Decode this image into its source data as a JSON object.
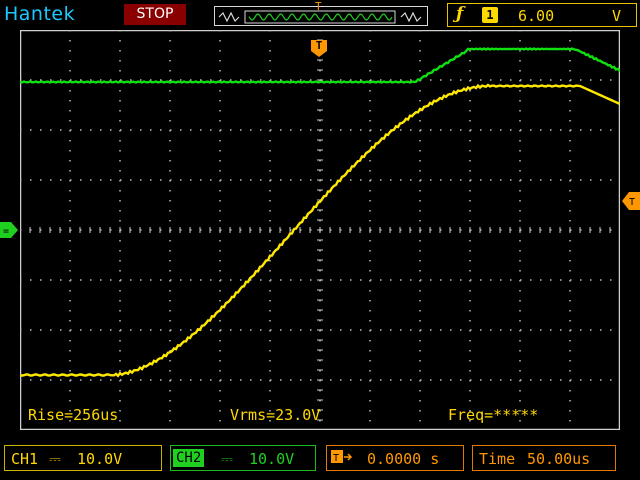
{
  "header": {
    "brand": "Hantek",
    "run_state": "STOP",
    "trigger_marker": "T",
    "trigger_icon": "trigger-edge-icon",
    "trigger_channel": "1",
    "trigger_level": "6.00",
    "trigger_unit": "V"
  },
  "screen": {
    "trigger_position_label": "T",
    "colors": {
      "ch1": "#ffe800",
      "ch2": "#10e010",
      "grid": "#ffffff",
      "trigger": "#ff9800"
    }
  },
  "measurements": {
    "rise": "Rise=256us",
    "vrms": "Vrms=23.0V",
    "freq": "Freq=*****"
  },
  "footer": {
    "ch1_label": "CH1",
    "ch1_scale": "10.0V",
    "ch2_label": "CH2",
    "ch2_scale": "10.0V",
    "time_offset": "0.0000 s",
    "timebase_label": "Time",
    "timebase_value": "50.00us"
  }
}
